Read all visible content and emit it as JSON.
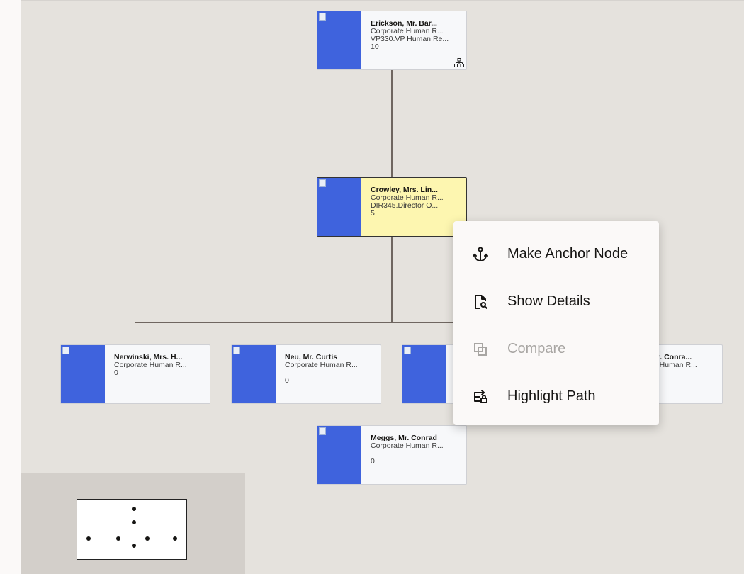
{
  "org_chart": {
    "nodes": [
      {
        "id": "erickson",
        "name": "Erickson, Mr. Bar...",
        "line1": "Corporate Human R...",
        "line2": "VP330.VP Human Re...",
        "count": "10",
        "has_children_icon": true
      },
      {
        "id": "crowley",
        "name": "Crowley, Mrs. Lin...",
        "line1": "Corporate Human R...",
        "line2": "DIR345.Director O...",
        "count": "5",
        "selected": true
      },
      {
        "id": "nerwinski",
        "name": "Nerwinski, Mrs. H...",
        "line1": "Corporate Human R...",
        "line2": "",
        "count": "0"
      },
      {
        "id": "neu",
        "name": "Neu, Mr. Curtis",
        "line1": "Corporate Human R...",
        "line2": "",
        "count": "0"
      },
      {
        "id": "hidden",
        "name": "",
        "line1": "",
        "line2": "",
        "count": ""
      },
      {
        "id": "conrad-right",
        "name": "Mr. Conra...",
        "line1": "te Human R...",
        "line2": "",
        "count": ""
      },
      {
        "id": "meggs",
        "name": "Meggs, Mr. Conrad",
        "line1": "Corporate Human R...",
        "line2": "",
        "count": "0"
      }
    ]
  },
  "context_menu": {
    "items": [
      {
        "label": "Make Anchor Node",
        "icon": "anchor-icon",
        "enabled": true
      },
      {
        "label": "Show Details",
        "icon": "document-search-icon",
        "enabled": true
      },
      {
        "label": "Compare",
        "icon": "compare-icon",
        "enabled": false
      },
      {
        "label": "Highlight Path",
        "icon": "highlight-path-icon",
        "enabled": true
      }
    ]
  },
  "colors": {
    "canvas": "#e5e2dd",
    "photo_placeholder": "#3f63dd",
    "selected_node": "#fdf6b0",
    "connector": "#6f6660",
    "overview_bg": "#d3cfca"
  }
}
